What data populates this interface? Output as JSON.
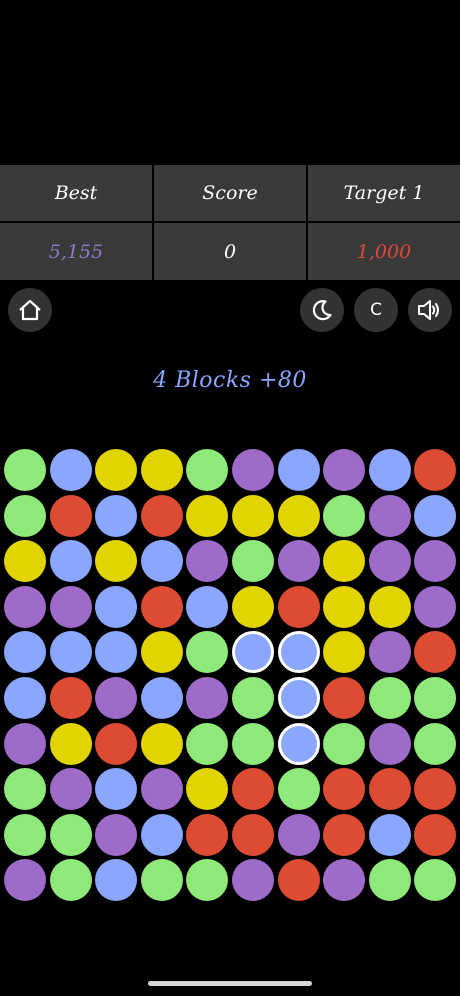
{
  "scoreboard": {
    "best_label": "Best",
    "score_label": "Score",
    "target_label": "Target 1",
    "best_value": "5,155",
    "score_value": "0",
    "target_value": "1,000",
    "best_color": "#8f78c9",
    "target_color": "#e0483a"
  },
  "controls": {
    "home_icon": "home-icon",
    "theme_icon": "moon-icon",
    "clear_label": "C",
    "sound_icon": "speaker-icon"
  },
  "status_text": "4 Blocks +80",
  "colors": {
    "G": "#8fe87a",
    "B": "#8aa6ff",
    "Y": "#e1d400",
    "P": "#9f6bc9",
    "R": "#dd4b33"
  },
  "grid": [
    [
      "G",
      "B",
      "Y",
      "Y",
      "G",
      "P",
      "B",
      "P",
      "B",
      "R"
    ],
    [
      "G",
      "R",
      "B",
      "R",
      "Y",
      "Y",
      "Y",
      "G",
      "P",
      "B"
    ],
    [
      "Y",
      "B",
      "Y",
      "B",
      "P",
      "G",
      "P",
      "Y",
      "P",
      "P"
    ],
    [
      "P",
      "P",
      "B",
      "R",
      "B",
      "Y",
      "R",
      "Y",
      "Y",
      "P"
    ],
    [
      "B",
      "B",
      "B",
      "Y",
      "G",
      "B",
      "B",
      "Y",
      "P",
      "R"
    ],
    [
      "B",
      "R",
      "P",
      "B",
      "P",
      "G",
      "B",
      "R",
      "G",
      "G"
    ],
    [
      "P",
      "Y",
      "R",
      "Y",
      "G",
      "G",
      "B",
      "G",
      "P",
      "G"
    ],
    [
      "G",
      "P",
      "B",
      "P",
      "Y",
      "R",
      "G",
      "R",
      "R",
      "R"
    ],
    [
      "G",
      "G",
      "P",
      "B",
      "R",
      "R",
      "P",
      "R",
      "B",
      "R"
    ],
    [
      "P",
      "G",
      "B",
      "G",
      "G",
      "P",
      "R",
      "P",
      "G",
      "G"
    ]
  ],
  "selected": [
    [
      4,
      5
    ],
    [
      4,
      6
    ],
    [
      5,
      6
    ],
    [
      6,
      6
    ]
  ]
}
